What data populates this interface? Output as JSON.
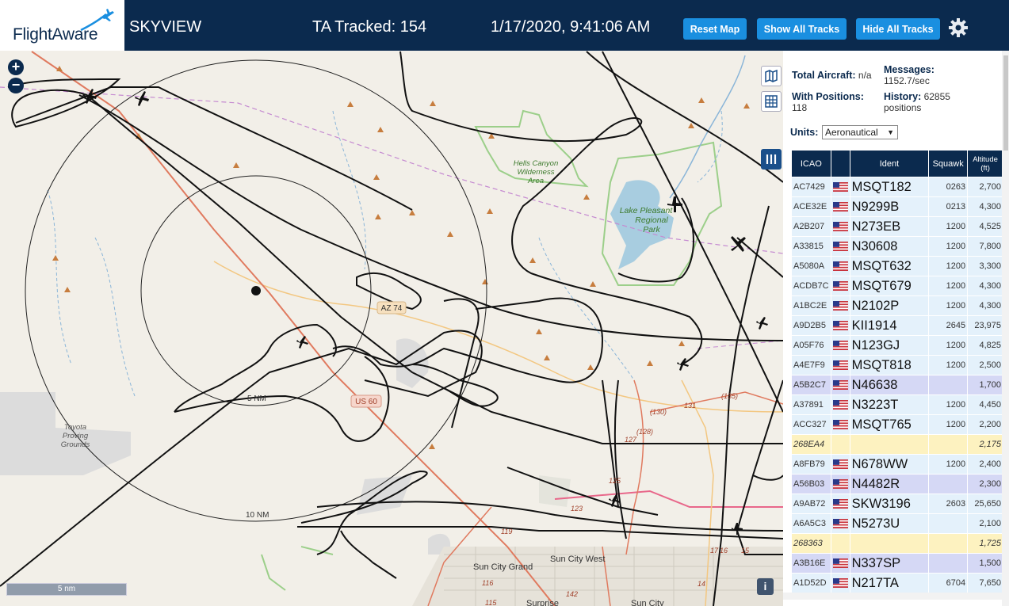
{
  "header": {
    "logo_text": "FlightAware",
    "app_title": "SKYVIEW",
    "tracked": "TA Tracked: 154",
    "datetime": "1/17/2020, 9:41:06 AM",
    "reset_label": "Reset Map",
    "show_label": "Show All Tracks",
    "hide_label": "Hide All Tracks"
  },
  "map": {
    "labels": {
      "hells_canyon": "Hells Canyon\nWilderness\nArea",
      "lake_pleasant": "Lake Pleasant\nRegional\nPark",
      "toyota": "Toyota\nProving\nGrounds",
      "az74": "AZ 74",
      "us60": "US 60",
      "ring5": "5 NM",
      "ring10": "10 NM",
      "sun_city_grand": "Sun City Grand",
      "sun_city_west": "Sun City West",
      "surprise": "Surprise",
      "sun_city": "Sun City"
    },
    "road_numbers": [
      "(128)",
      "(130)",
      "131",
      "(135)",
      "127",
      "125",
      "123",
      "119",
      "116",
      "142",
      "115",
      "17",
      "16",
      "15",
      "14"
    ],
    "scale_label": "5 nm",
    "info_label": "i"
  },
  "stats": {
    "total_label": "Total Aircraft:",
    "total_value": "n/a",
    "positions_label": "With Positions:",
    "positions_value": "118",
    "messages_label": "Messages:",
    "messages_value": "1152.7/sec",
    "history_label": "History:",
    "history_value": "62855 positions",
    "units_label": "Units:",
    "units_value": "Aeronautical"
  },
  "table": {
    "headers": [
      "ICAO",
      "",
      "Ident",
      "Squawk",
      "Altitude (ft)"
    ],
    "rows": [
      {
        "icao": "AC7429",
        "flag": true,
        "ident": "MSQT182",
        "squawk": "0263",
        "alt": "2,700",
        "style": "blue"
      },
      {
        "icao": "ACE32E",
        "flag": true,
        "ident": "N9299B",
        "squawk": "0213",
        "alt": "4,300",
        "style": "blue"
      },
      {
        "icao": "A2B207",
        "flag": true,
        "ident": "N273EB",
        "squawk": "1200",
        "alt": "4,525",
        "style": "blue"
      },
      {
        "icao": "A33815",
        "flag": true,
        "ident": "N30608",
        "squawk": "1200",
        "alt": "7,800",
        "style": "blue"
      },
      {
        "icao": "A5080A",
        "flag": true,
        "ident": "MSQT632",
        "squawk": "1200",
        "alt": "3,300",
        "style": "blue"
      },
      {
        "icao": "ACDB7C",
        "flag": true,
        "ident": "MSQT679",
        "squawk": "1200",
        "alt": "4,300",
        "style": "blue"
      },
      {
        "icao": "A1BC2E",
        "flag": true,
        "ident": "N2102P",
        "squawk": "1200",
        "alt": "4,300",
        "style": "blue"
      },
      {
        "icao": "A9D2B5",
        "flag": true,
        "ident": "KII1914",
        "squawk": "2645",
        "alt": "23,975",
        "style": "blue"
      },
      {
        "icao": "A05F76",
        "flag": true,
        "ident": "N123GJ",
        "squawk": "1200",
        "alt": "4,825",
        "style": "blue"
      },
      {
        "icao": "A4E7F9",
        "flag": true,
        "ident": "MSQT818",
        "squawk": "1200",
        "alt": "2,500",
        "style": "blue"
      },
      {
        "icao": "A5B2C7",
        "flag": true,
        "ident": "N46638",
        "squawk": "",
        "alt": "1,700",
        "style": "purple"
      },
      {
        "icao": "A37891",
        "flag": true,
        "ident": "N3223T",
        "squawk": "1200",
        "alt": "4,450",
        "style": "blue"
      },
      {
        "icao": "ACC327",
        "flag": true,
        "ident": "MSQT765",
        "squawk": "1200",
        "alt": "2,200",
        "style": "blue"
      },
      {
        "icao": "268EA4",
        "flag": false,
        "ident": "",
        "squawk": "",
        "alt": "2,175",
        "style": "yellow"
      },
      {
        "icao": "A8FB79",
        "flag": true,
        "ident": "N678WW",
        "squawk": "1200",
        "alt": "2,400",
        "style": "blue"
      },
      {
        "icao": "A56B03",
        "flag": true,
        "ident": "N4482R",
        "squawk": "",
        "alt": "2,300",
        "style": "purple"
      },
      {
        "icao": "A9AB72",
        "flag": true,
        "ident": "SKW3196",
        "squawk": "2603",
        "alt": "25,650",
        "style": "blue"
      },
      {
        "icao": "A6A5C3",
        "flag": true,
        "ident": "N5273U",
        "squawk": "",
        "alt": "2,100",
        "style": "blue"
      },
      {
        "icao": "268363",
        "flag": false,
        "ident": "",
        "squawk": "",
        "alt": "1,725",
        "style": "yellow"
      },
      {
        "icao": "A3B16E",
        "flag": true,
        "ident": "N337SP",
        "squawk": "",
        "alt": "1,500",
        "style": "purple"
      },
      {
        "icao": "A1D52D",
        "flag": true,
        "ident": "N217TA",
        "squawk": "6704",
        "alt": "7,650",
        "style": "blue"
      }
    ]
  }
}
